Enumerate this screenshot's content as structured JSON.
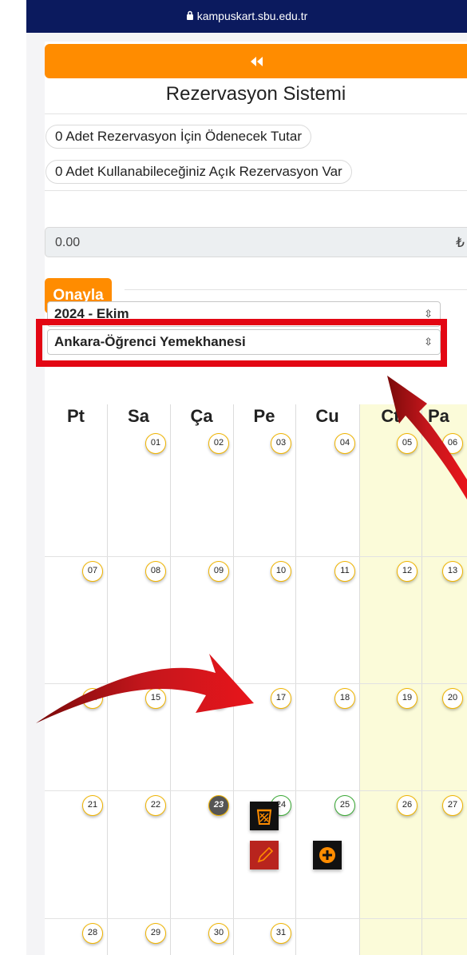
{
  "browser": {
    "url": "kampuskart.sbu.edu.tr",
    "lock_icon": "lock-icon"
  },
  "header": {
    "back_icon": "double-chevron-left-icon",
    "title": "Rezervasyon Sistemi"
  },
  "summary": {
    "payment_text": "0 Adet Rezervasyon İçin Ödenecek Tutar",
    "open_reservations_text": "0 Adet Kullanabileceğiniz Açık Rezervasyon Var",
    "amount_value": "0.00",
    "currency_symbol": "₺"
  },
  "confirm_label": "Onayla",
  "filters": {
    "month_value": "2024 - Ekim",
    "location_value": "Ankara-Öğrenci Yemekhanesi"
  },
  "calendar": {
    "day_names": [
      "Pt",
      "Sa",
      "Ça",
      "Pe",
      "Cu",
      "Ct",
      "Pa"
    ],
    "weeks": [
      [
        "",
        "01",
        "02",
        "03",
        "04",
        "05",
        "06"
      ],
      [
        "07",
        "08",
        "09",
        "10",
        "11",
        "12",
        "13"
      ],
      [
        "14",
        "15",
        "16",
        "17",
        "18",
        "19",
        "20"
      ],
      [
        "21",
        "22",
        "23",
        "24",
        "25",
        "26",
        "27"
      ],
      [
        "28",
        "29",
        "30",
        "31",
        "",
        "",
        ""
      ]
    ],
    "today": "23",
    "green_days": [
      "24",
      "25"
    ]
  },
  "actions": {
    "delete_icon": "trash-basket-icon",
    "edit_icon": "pencil-icon",
    "add_icon": "plus-circle-icon"
  },
  "colors": {
    "accent_orange": "#ff8c00",
    "browser_bar": "#0b1a5e",
    "highlight_red": "#e30613",
    "weekend_yellow": "#fbfbd9",
    "badge_yellow": "#f0b400",
    "badge_green": "#3aa935"
  }
}
